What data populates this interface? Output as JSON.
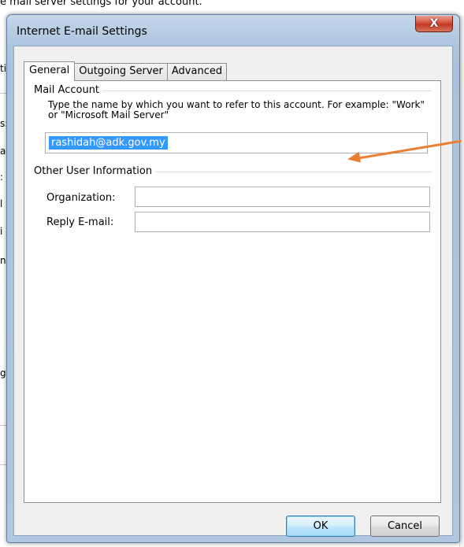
{
  "background": {
    "top_text": "e mail server settings for your account.",
    "fragments": [
      "ti",
      "s:",
      "a",
      ":",
      "l",
      "i",
      "n",
      "g"
    ]
  },
  "dialog": {
    "title": "Internet E-mail Settings",
    "close_glyph": "X"
  },
  "tabs": [
    {
      "label": "General",
      "active": true
    },
    {
      "label": "Outgoing Server",
      "active": false
    },
    {
      "label": "Advanced",
      "active": false
    }
  ],
  "mail_account": {
    "group_title": "Mail Account",
    "description": "Type the name by which you want to refer to this account. For example: \"Work\" or \"Microsoft Mail Server\"",
    "account_name_value": "rashidah@adk.gov.my"
  },
  "other_user_info": {
    "group_title": "Other User Information",
    "organization_label": "Organization:",
    "organization_value": "",
    "reply_email_label": "Reply E-mail:",
    "reply_email_value": ""
  },
  "buttons": {
    "ok_label": "OK",
    "cancel_label": "Cancel"
  },
  "colors": {
    "annotation_arrow": "#ed7d31",
    "selection": "#3399ff",
    "close_button": "#c23a22"
  },
  "icons": [
    "close-icon",
    "annotation-arrow-icon"
  ]
}
